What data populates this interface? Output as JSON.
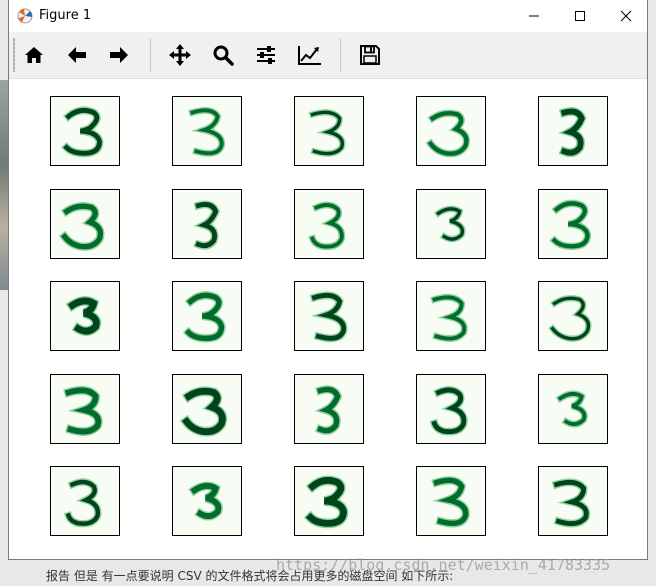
{
  "window": {
    "title": "Figure 1",
    "controls": {
      "minimize": "minimize-icon",
      "maximize": "maximize-icon",
      "close": "close-icon"
    }
  },
  "toolbar": {
    "buttons": [
      {
        "name": "home",
        "icon": "home-icon"
      },
      {
        "name": "back",
        "icon": "arrow-left-icon"
      },
      {
        "name": "forward",
        "icon": "arrow-right-icon"
      },
      {
        "name": "pan",
        "icon": "move-icon"
      },
      {
        "name": "zoom",
        "icon": "magnifier-icon"
      },
      {
        "name": "subplots",
        "icon": "sliders-icon"
      },
      {
        "name": "edit-axes",
        "icon": "line-chart-icon"
      },
      {
        "name": "save",
        "icon": "floppy-disk-icon"
      }
    ]
  },
  "figure": {
    "grid_rows": 5,
    "grid_cols": 5,
    "digit_label": "3",
    "colormap": "Greens",
    "cell_background": "#f7fcf5",
    "stroke_colors": [
      "#00441b",
      "#006d2c",
      "#238b45",
      "#41ab5d"
    ]
  },
  "page_below": {
    "text": "报告 但是 有一点要说明 CSV 的文件格式将会占用更多的磁盘空间 如下所示:",
    "watermark": "https://blog.csdn.net/weixin_41783335"
  }
}
